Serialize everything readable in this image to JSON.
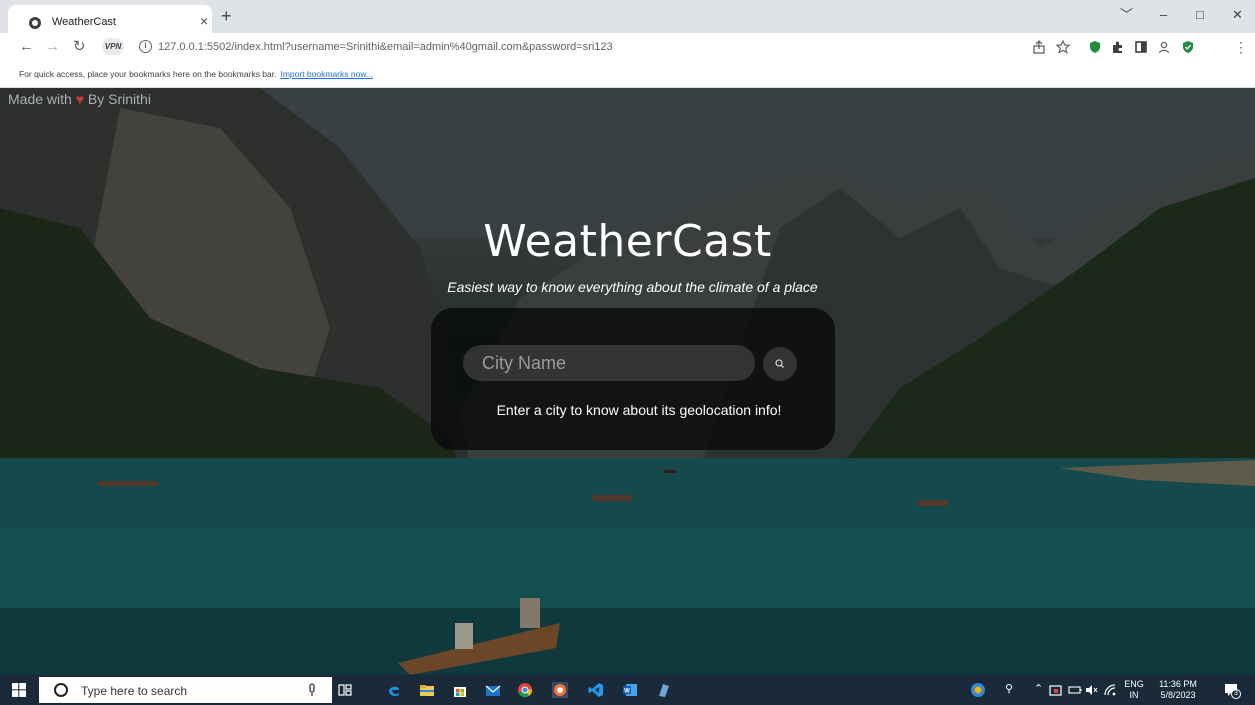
{
  "browser": {
    "tab_title": "WeatherCast",
    "tab_close": "×",
    "new_tab": "+",
    "url": "127.0.0.1:5502/index.html?username=Srinithi&email=admin%40gmail.com&password=sri123",
    "vpn_label": "VPN",
    "bookmarks_hint": "For quick access, place your bookmarks here on the bookmarks bar.",
    "bookmarks_link": "Import bookmarks now...",
    "window_controls": [
      "﹀",
      "–",
      "□",
      "✕"
    ]
  },
  "page": {
    "credit_prefix": "Made with",
    "credit_heart": "♥",
    "credit_suffix": "By Srinithi",
    "title": "WeatherCast",
    "tagline": "Easiest way to know everything about the climate of a place",
    "city_placeholder": "City Name",
    "city_value": "",
    "geo_message": "Enter a city to know about its geolocation info!"
  },
  "taskbar": {
    "search_placeholder": "Type here to search",
    "language_top": "ENG",
    "language_bottom": "IN",
    "time": "11:36 PM",
    "date": "5/8/2023",
    "notification_count": "3"
  },
  "colors": {
    "taskbar_bg": "#1b2a38",
    "card_bg": "rgba(8,10,12,0.82)",
    "heart": "#c43b3b"
  }
}
